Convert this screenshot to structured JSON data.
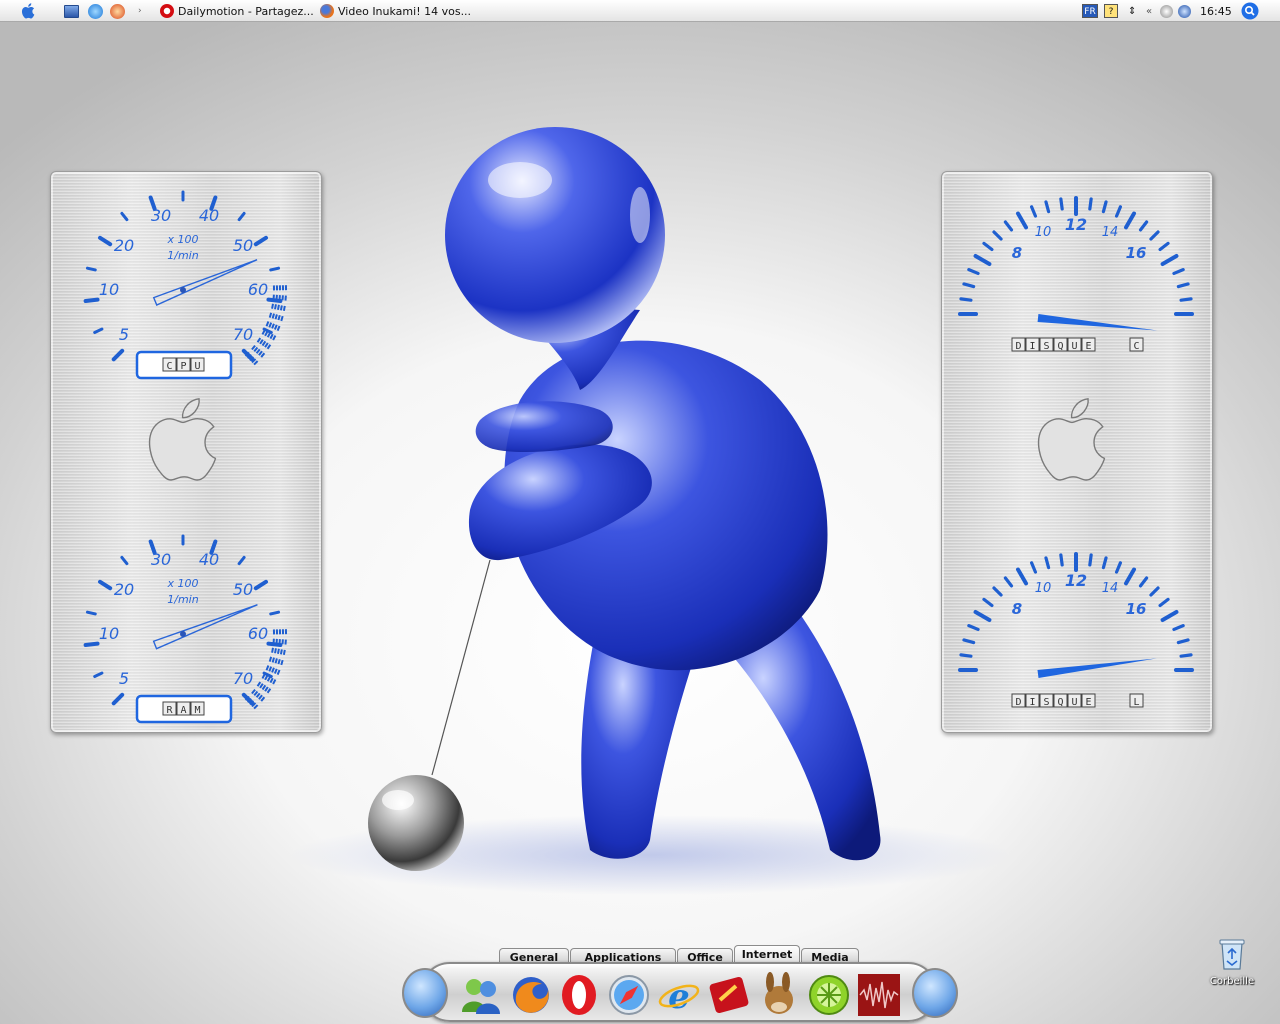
{
  "topbar": {
    "tasks": [
      {
        "title": "Dailymotion - Partagez..."
      },
      {
        "title": "Video Inukami! 14 vos..."
      }
    ],
    "tray": {
      "lang": "FR",
      "help": "?",
      "clock": "16:45"
    }
  },
  "gauges": {
    "cpu": {
      "multiplier": "x 100",
      "unit": "1/min",
      "ticks": [
        "5",
        "10",
        "20",
        "30",
        "40",
        "50",
        "60",
        "70"
      ],
      "label": [
        "C",
        "P",
        "U"
      ],
      "value": 5.9
    },
    "ram": {
      "multiplier": "x 100",
      "unit": "1/min",
      "ticks": [
        "5",
        "10",
        "20",
        "30",
        "40",
        "50",
        "60",
        "70"
      ],
      "label": [
        "R",
        "A",
        "M"
      ],
      "value": 6.1
    },
    "disk_c": {
      "ticks": [
        "8",
        "10",
        "12",
        "14",
        "16"
      ],
      "label": [
        "D",
        "I",
        "S",
        "Q",
        "U",
        "E"
      ],
      "drive": "C",
      "value": 18.4
    },
    "disk_l": {
      "ticks": [
        "8",
        "10",
        "12",
        "14",
        "16"
      ],
      "label": [
        "D",
        "I",
        "S",
        "Q",
        "U",
        "E"
      ],
      "drive": "L",
      "value": 17.5
    }
  },
  "dock": {
    "tabs": [
      {
        "label": "General"
      },
      {
        "label": "Applications"
      },
      {
        "label": "Office"
      },
      {
        "label": "Internet"
      },
      {
        "label": "Media"
      }
    ],
    "active_tab": "Internet",
    "icons": [
      "messenger-icon",
      "firefox-icon",
      "opera-icon",
      "safari-icon",
      "internet-explorer-icon",
      "filezilla-icon",
      "emule-icon",
      "limewire-icon",
      "audio-wave-icon"
    ]
  },
  "desktop": {
    "trash_label": "Corbeille"
  },
  "colors": {
    "accent_blue": "#1a5fd6",
    "figure_blue": "#1f3fd0"
  }
}
